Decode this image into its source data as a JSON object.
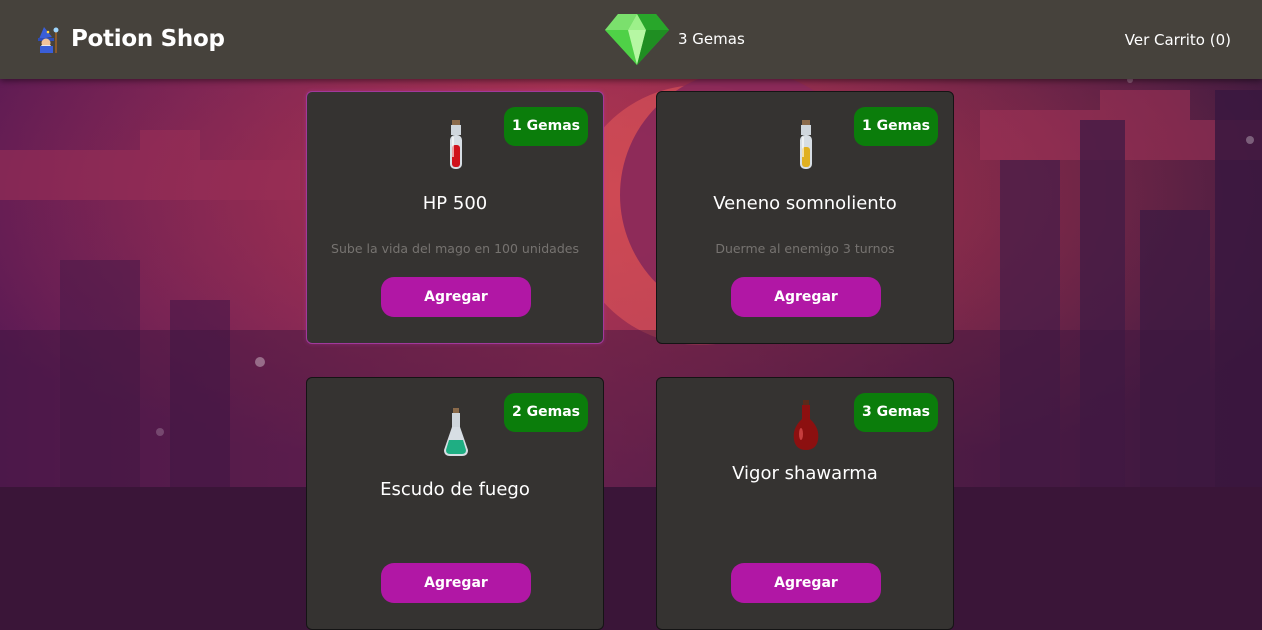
{
  "header": {
    "brand_title": "Potion Shop",
    "gems_label": "3 Gemas",
    "cart_label": "Ver Carrito (0)"
  },
  "products": [
    {
      "name": "HP 500",
      "price": "1 Gemas",
      "description": "Sube la vida del mago en 100 unidades",
      "button": "Agregar",
      "potion_color": "#d0111b"
    },
    {
      "name": "Veneno somnoliento",
      "price": "1 Gemas",
      "description": "Duerme al enemigo 3 turnos",
      "button": "Agregar",
      "potion_color": "#e0b020"
    },
    {
      "name": "Escudo de fuego",
      "price": "2 Gemas",
      "description": "",
      "button": "Agregar",
      "potion_color": "#1fae83"
    },
    {
      "name": "Vigor shawarma",
      "price": "3 Gemas",
      "description": "",
      "button": "Agregar",
      "potion_color": "#8c1010"
    }
  ],
  "colors": {
    "header_bg": "#46423c",
    "card_bg": "#353331",
    "badge_green": "#0b7d0b",
    "button_magenta": "#b117a5"
  },
  "icons": [
    "wizard-icon",
    "gem-icon",
    "potion-icon"
  ]
}
